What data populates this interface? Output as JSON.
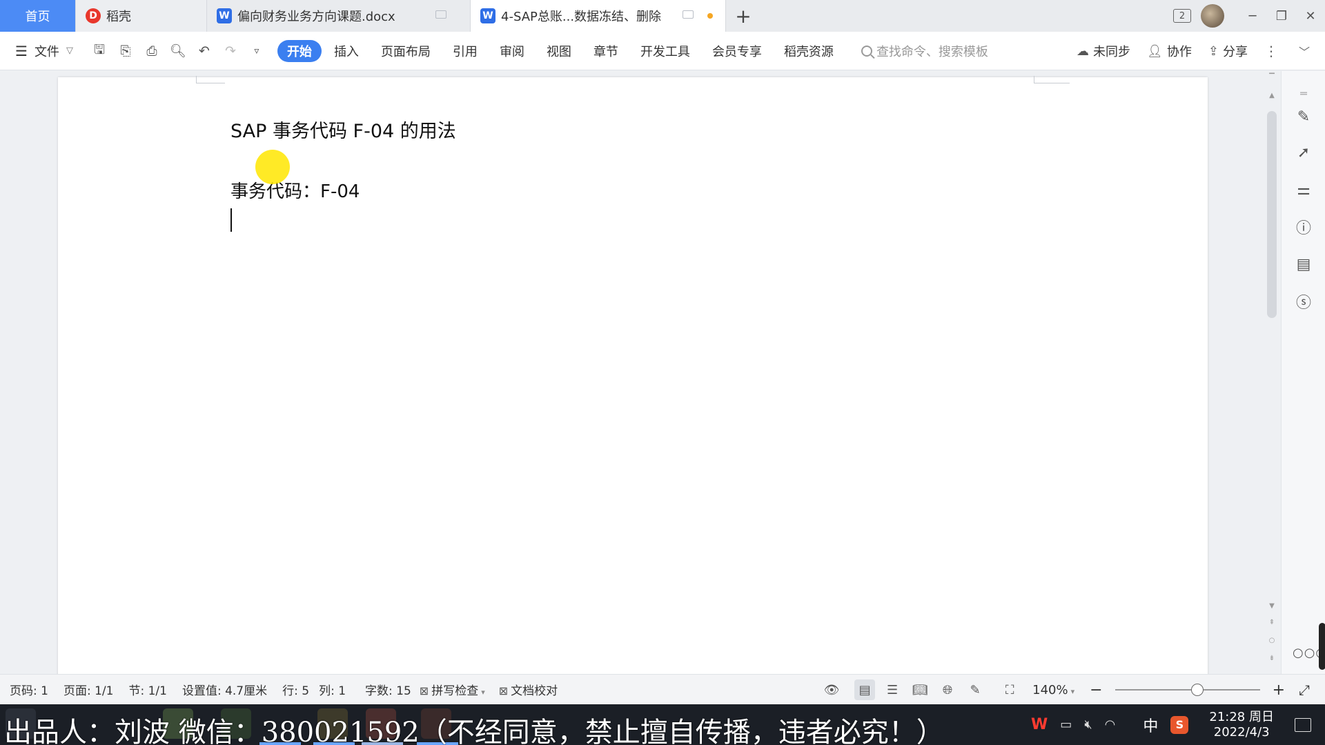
{
  "tabs": {
    "home": "首页",
    "daoke": "稻壳",
    "doc1": "偏向财务业务方向课题.docx",
    "doc2": "4-SAP总账...数据冻结、删除",
    "new_tab": "+"
  },
  "window": {
    "badge": "2"
  },
  "toolbar": {
    "file": "文件",
    "menus": [
      "开始",
      "插入",
      "页面布局",
      "引用",
      "审阅",
      "视图",
      "章节",
      "开发工具",
      "会员专享",
      "稻壳资源"
    ],
    "search_placeholder": "查找命令、搜索模板",
    "sync": "未同步",
    "collab": "协作",
    "share": "分享"
  },
  "document": {
    "line1": "SAP 事务代码 F-04 的用法",
    "line2": "事务代码：F-04"
  },
  "status": {
    "page_code": "页码: 1",
    "page": "页面: 1/1",
    "section": "节: 1/1",
    "setting": "设置值: 4.7厘米",
    "row": "行: 5",
    "col": "列: 1",
    "words": "字数: 15",
    "spell": "拼写检查",
    "proof": "文档校对",
    "zoom": "140%"
  },
  "taskbar": {
    "watermark": "出品人：刘波    微信：380021592（不经同意，禁止擅自传播，违者必究！）",
    "ime": "中",
    "time": "21:28 周日",
    "date": "2022/4/3"
  },
  "colors": {
    "accent": "#3b7ff0",
    "home_tab": "#4c8bf5",
    "pointer": "#ffe600",
    "taskbar": "#1b1f26"
  }
}
